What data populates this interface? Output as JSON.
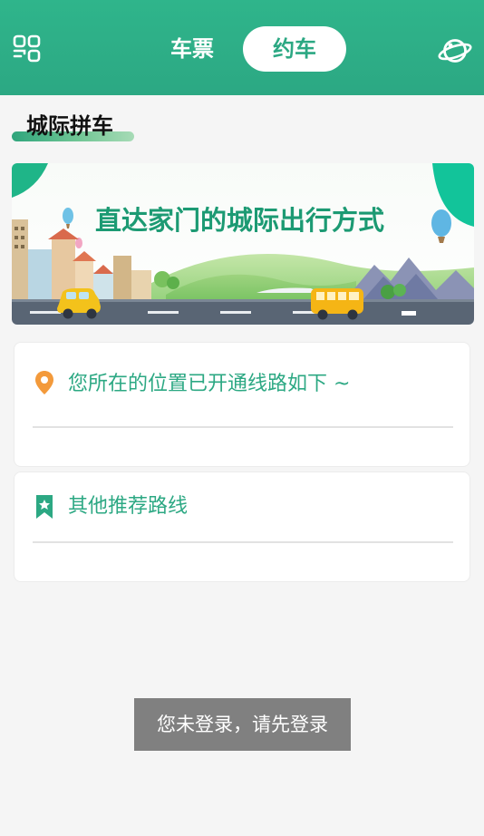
{
  "header": {
    "tabs": [
      {
        "label": "车票",
        "active": false
      },
      {
        "label": "约车",
        "active": true
      }
    ],
    "left_icon": "grid-menu-icon",
    "right_icon": "planet-icon",
    "accent": "#2ca883"
  },
  "section": {
    "title": "城际拼车"
  },
  "banner": {
    "headline": "直达家门的城际出行方式"
  },
  "cards": [
    {
      "icon": "location-pin-icon",
      "icon_color": "#f39a3b",
      "label": "您所在的位置已开通线路如下 ~"
    },
    {
      "icon": "bookmark-star-icon",
      "icon_color": "#2ca883",
      "label": "其他推荐路线"
    }
  ],
  "toast": {
    "message": "您未登录，请先登录"
  }
}
